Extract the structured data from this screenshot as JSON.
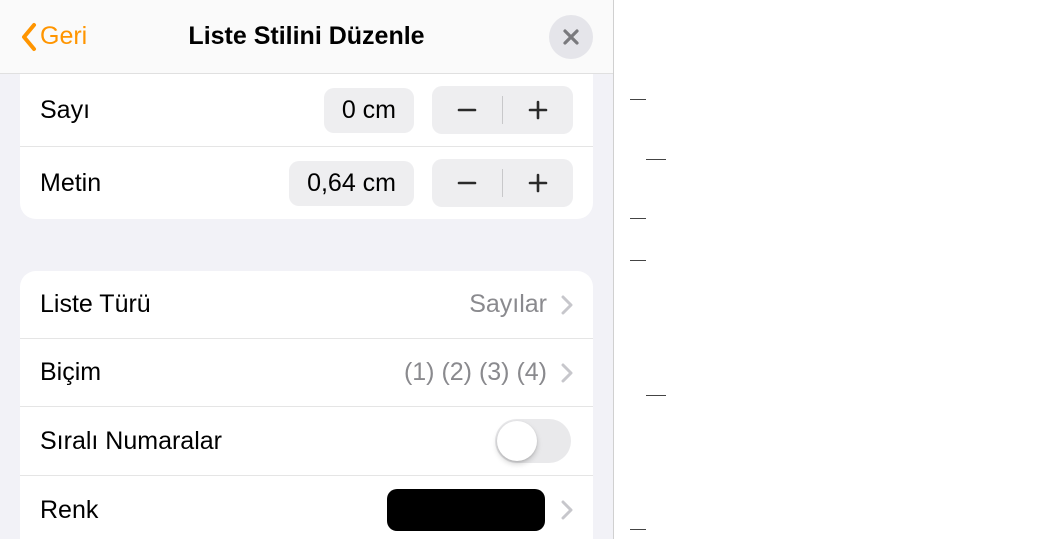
{
  "header": {
    "back_label": "Geri",
    "title": "Liste Stilini Düzenle"
  },
  "indent": {
    "number": {
      "label": "Sayı",
      "value": "0 cm"
    },
    "text": {
      "label": "Metin",
      "value": "0,64 cm"
    }
  },
  "options": {
    "list_type": {
      "label": "Liste Türü",
      "value": "Sayılar"
    },
    "format": {
      "label": "Biçim",
      "value": "(1) (2) (3) (4)"
    },
    "ordered": {
      "label": "Sıralı Numaralar",
      "on": false
    },
    "color": {
      "label": "Renk",
      "value": "#000000"
    }
  }
}
